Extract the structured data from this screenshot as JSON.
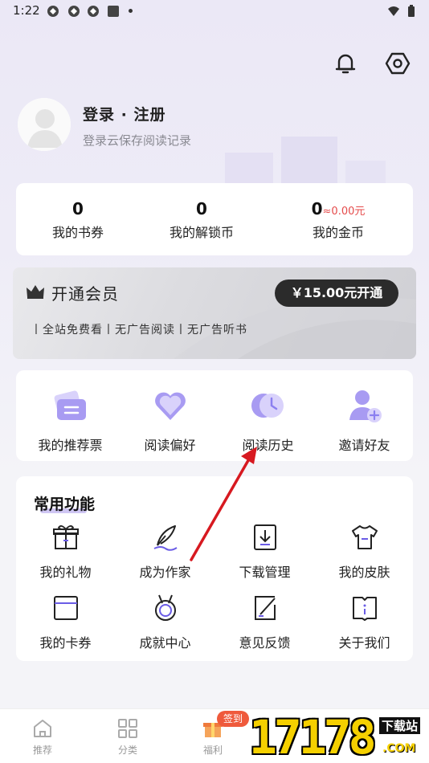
{
  "status_bar": {
    "time": "1:22"
  },
  "profile": {
    "title": "登录 · 注册",
    "subtitle": "登录云保存阅读记录"
  },
  "stats": [
    {
      "value": "0",
      "label": "我的书券"
    },
    {
      "value": "0",
      "label": "我的解锁币"
    },
    {
      "value": "0",
      "extra": "≈0.00元",
      "label": "我的金币"
    }
  ],
  "vip": {
    "title": "开通会员",
    "benefits": "丨全站免费看丨无广告阅读丨无广告听书",
    "button": "￥15.00元开通"
  },
  "quick_actions": [
    {
      "label": "我的推荐票",
      "icon": "ticket-icon"
    },
    {
      "label": "阅读偏好",
      "icon": "heart-icon"
    },
    {
      "label": "阅读历史",
      "icon": "clock-icon"
    },
    {
      "label": "邀请好友",
      "icon": "add-friend-icon"
    }
  ],
  "functions": {
    "title": "常用功能",
    "items": [
      {
        "label": "我的礼物",
        "icon": "gift-icon"
      },
      {
        "label": "成为作家",
        "icon": "quill-icon"
      },
      {
        "label": "下载管理",
        "icon": "download-icon"
      },
      {
        "label": "我的皮肤",
        "icon": "shirt-icon"
      },
      {
        "label": "我的卡券",
        "icon": "card-icon"
      },
      {
        "label": "成就中心",
        "icon": "medal-icon"
      },
      {
        "label": "意见反馈",
        "icon": "feedback-icon"
      },
      {
        "label": "关于我们",
        "icon": "info-book-icon"
      }
    ]
  },
  "bottom_nav": [
    {
      "label": "推荐",
      "icon": "home-icon"
    },
    {
      "label": "分类",
      "icon": "grid-icon"
    },
    {
      "label": "福利",
      "icon": "gift-icon",
      "badge": "签到"
    }
  ],
  "watermark": {
    "number": "17178",
    "site": "下载站",
    "domain": ".COM"
  },
  "colors": {
    "accent": "#8b7ff0",
    "coin": "#e54b4b",
    "badge": "#ef5a3c",
    "vip_button": "#2b2b2b"
  }
}
